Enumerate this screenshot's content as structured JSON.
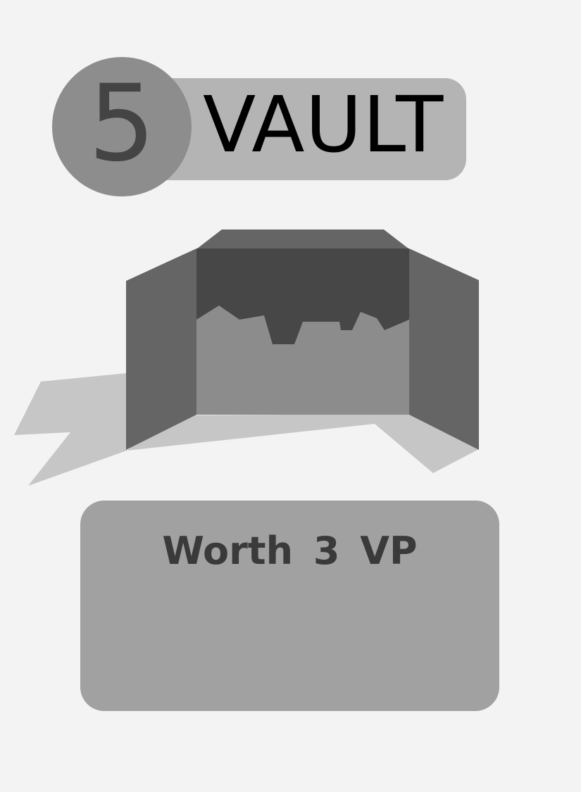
{
  "card": {
    "cost": "5",
    "title": "VAULT",
    "ability_text": "Worth 3 VP"
  },
  "colors": {
    "background": "#f3f3f3",
    "title_banner": "#b4b4b4",
    "cost_circle": "#8d8d8d",
    "text_box": "#a1a1a1",
    "vault_dark": "#474747",
    "vault_wall": "#656565",
    "vault_floor": "#8c8c8c",
    "shadow": "#c6c6c6"
  },
  "art": {
    "icon": "vault-open-icon"
  }
}
